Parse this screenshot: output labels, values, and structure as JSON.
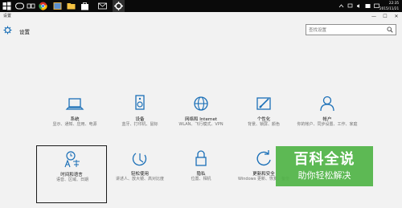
{
  "taskbar": {
    "clock": {
      "time": "22:35",
      "date": "2015/11/21"
    },
    "icons": [
      "windows-start-icon",
      "search-icon",
      "task-view-icon",
      "chrome-icon",
      "photos-icon",
      "file-explorer-icon",
      "store-icon",
      "mail-icon",
      "settings-icon"
    ]
  },
  "window": {
    "title": "设置",
    "minimize": "—",
    "maximize": "☐",
    "close": "✕"
  },
  "header": {
    "title": "设置",
    "search_placeholder": "查找设置"
  },
  "tiles": [
    {
      "name": "系统",
      "desc": "显示、通知、应用、电源",
      "icon": "laptop-icon"
    },
    {
      "name": "设备",
      "desc": "蓝牙、打印机、鼠标",
      "icon": "keyboard-speaker-icon"
    },
    {
      "name": "网络和 Internet",
      "desc": "WLAN、飞行模式、VPN",
      "icon": "globe-icon"
    },
    {
      "name": "个性化",
      "desc": "背景、锁屏、颜色",
      "icon": "paint-brush-icon"
    },
    {
      "name": "帐户",
      "desc": "你的帐户、同步设置、工作、家庭",
      "icon": "person-icon"
    },
    {
      "name": "时间和语言",
      "desc": "语音、区域、日期",
      "icon": "time-language-icon"
    },
    {
      "name": "轻松使用",
      "desc": "讲述人、放大镜、高对比度",
      "icon": "ease-of-access-icon"
    },
    {
      "name": "隐私",
      "desc": "位置、相机",
      "icon": "lock-icon"
    },
    {
      "name": "更新和安全",
      "desc": "Windows 更新、恢复、备份",
      "icon": "refresh-icon"
    }
  ],
  "watermark": {
    "line1": "百科全说",
    "line2": "助你轻松解决"
  },
  "colors": {
    "accent": "#1a6fb7",
    "taskbar": "#0a0a0a",
    "background": "#f2f2f2",
    "watermark": "#50b446"
  }
}
